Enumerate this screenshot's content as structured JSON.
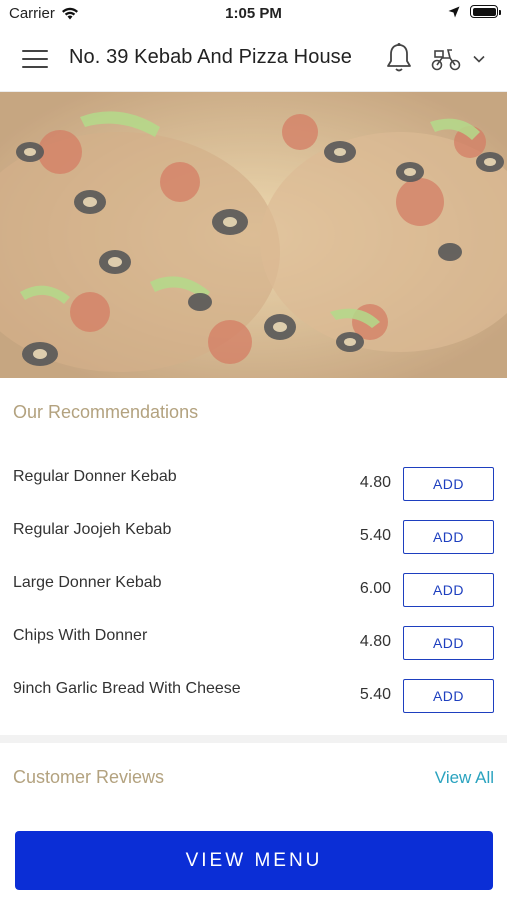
{
  "status_bar": {
    "carrier": "Carrier",
    "time": "1:05 PM"
  },
  "header": {
    "title": "No. 39 Kebab And Pizza House"
  },
  "recommendations": {
    "title": "Our Recommendations",
    "items": [
      {
        "name": "Regular Donner Kebab",
        "price": "4.80",
        "button": "ADD"
      },
      {
        "name": "Regular Joojeh Kebab",
        "price": "5.40",
        "button": "ADD"
      },
      {
        "name": "Large Donner Kebab",
        "price": "6.00",
        "button": "ADD"
      },
      {
        "name": "Chips With Donner",
        "price": "4.80",
        "button": "ADD"
      },
      {
        "name": "9inch Garlic Bread With Cheese",
        "price": "5.40",
        "button": "ADD"
      }
    ]
  },
  "reviews": {
    "title": "Customer Reviews",
    "view_all": "View All"
  },
  "footer": {
    "view_menu": "VIEW MENU"
  },
  "colors": {
    "accent_blue": "#0b2ed6",
    "section_title": "#b3a27f",
    "link": "#2aa3bf"
  }
}
